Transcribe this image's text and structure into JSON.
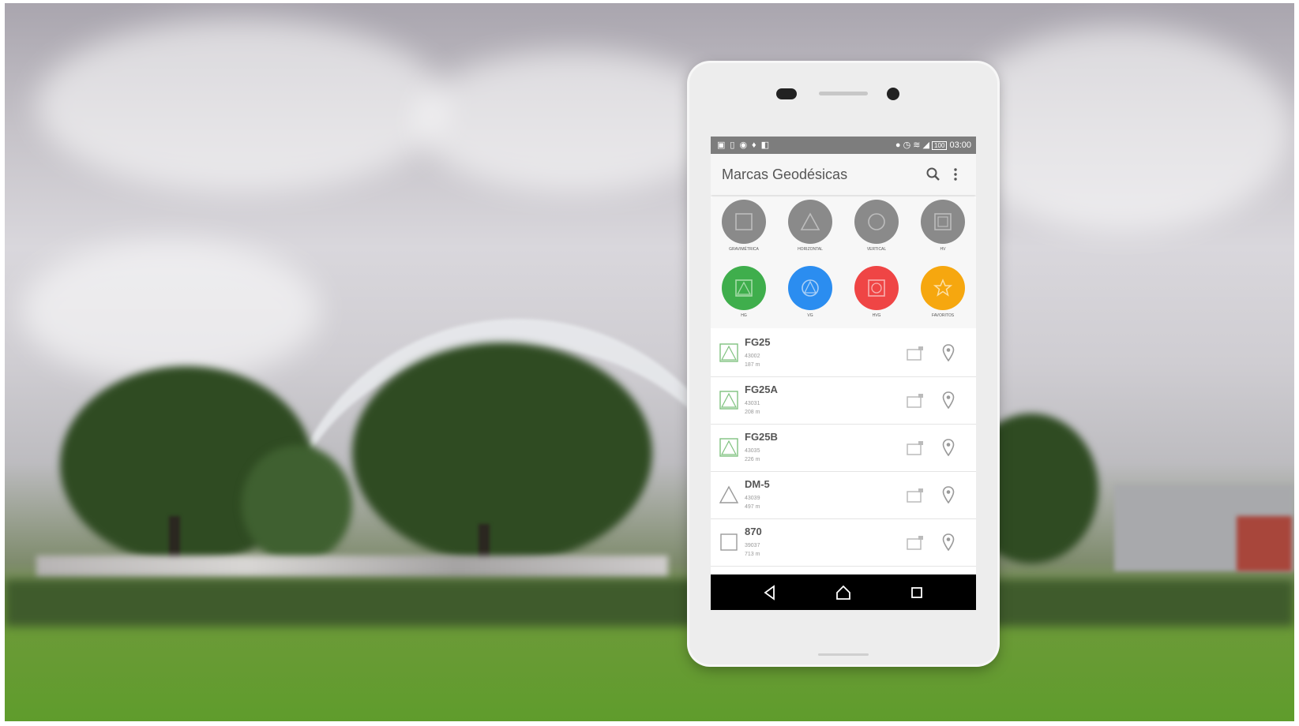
{
  "status_bar": {
    "left_icons": [
      "screenshot-icon",
      "sim-icon",
      "settings-icon",
      "nfc-icon",
      "app-icon"
    ],
    "battery": "100",
    "time": "03:00"
  },
  "app": {
    "title": "Marcas Geodésicas"
  },
  "filters": [
    {
      "label": "GRAVIMÉTRICA",
      "icon": "square-icon",
      "color": "#8a8a8a"
    },
    {
      "label": "HORIZONTAL",
      "icon": "triangle-icon",
      "color": "#8a8a8a"
    },
    {
      "label": "VERTICAL",
      "icon": "circle-icon",
      "color": "#8a8a8a"
    },
    {
      "label": "HV",
      "icon": "square-outline-icon",
      "color": "#8a8a8a"
    },
    {
      "label": "HG",
      "icon": "square-triangle-icon",
      "color": "#3fae4c"
    },
    {
      "label": "VG",
      "icon": "circle-triangle-icon",
      "color": "#2b8df0"
    },
    {
      "label": "HVG",
      "icon": "square-circle-icon",
      "color": "#ef4545"
    },
    {
      "label": "FAVORITOS",
      "icon": "star-icon",
      "color": "#f6a70f"
    }
  ],
  "marks": [
    {
      "name": "FG25",
      "id": "43002",
      "dist": "187 m",
      "icon": "square-triangle-icon",
      "color": "#7fc27f"
    },
    {
      "name": "FG25A",
      "id": "43031",
      "dist": "208 m",
      "icon": "square-triangle-icon",
      "color": "#7fc27f"
    },
    {
      "name": "FG25B",
      "id": "43035",
      "dist": "226 m",
      "icon": "square-triangle-icon",
      "color": "#7fc27f"
    },
    {
      "name": "DM-5",
      "id": "43039",
      "dist": "497 m",
      "icon": "triangle-icon",
      "color": "#9a9a9a"
    },
    {
      "name": "870",
      "id": "39037",
      "dist": "713 m",
      "icon": "square-icon",
      "color": "#9a9a9a"
    }
  ],
  "colors": {
    "fab": "#25dff0",
    "accent_green": "#3fae4c"
  }
}
